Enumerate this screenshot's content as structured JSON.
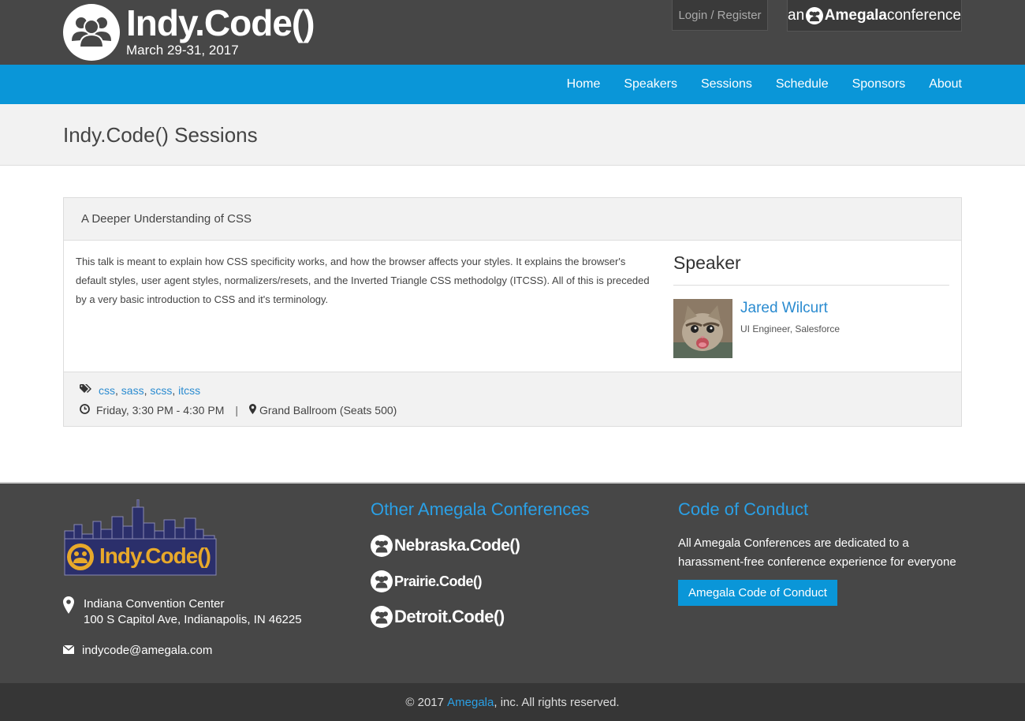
{
  "header": {
    "logo_title": "Indy.Code()",
    "logo_date": "March 29-31, 2017",
    "login_label": "Login / Register",
    "badge": {
      "prefix": "an",
      "brand": "Amegala",
      "suffix": "conference"
    }
  },
  "nav": {
    "items": [
      {
        "label": "Home"
      },
      {
        "label": "Speakers"
      },
      {
        "label": "Sessions"
      },
      {
        "label": "Schedule"
      },
      {
        "label": "Sponsors"
      },
      {
        "label": "About"
      }
    ]
  },
  "page": {
    "title": "Indy.Code() Sessions"
  },
  "session": {
    "title": "A Deeper Understanding of CSS",
    "description": "This talk is meant to explain how CSS specificity works, and how the browser affects your styles. It explains the browser's default styles, user agent styles, normalizers/resets, and the Inverted Triangle CSS methodolgy (ITCSS). All of this is preceded by a very basic introduction to CSS and it's terminology.",
    "speaker_heading": "Speaker",
    "speaker": {
      "name": "Jared Wilcurt",
      "title": "UI Engineer, Salesforce"
    },
    "tags": [
      "css",
      "sass",
      "scss",
      "itcss"
    ],
    "time": "Friday, 3:30 PM - 4:30 PM",
    "separator": "|",
    "room": "Grand Ballroom (Seats 500)"
  },
  "footer": {
    "logo_text": "Indy.Code()",
    "address_line1": "Indiana Convention Center",
    "address_line2": "100 S Capitol Ave, Indianapolis, IN 46225",
    "email": "indycode@amegala.com",
    "other_heading": "Other Amegala Conferences",
    "conferences": [
      {
        "label": "Nebraska.Code()"
      },
      {
        "label": "Prairie.Code()"
      },
      {
        "label": "Detroit.Code()"
      }
    ],
    "coc_heading": "Code of Conduct",
    "coc_text": "All Amegala Conferences are dedicated to a harassment-free conference experience for everyone",
    "coc_button": "Amegala Code of Conduct"
  },
  "copyright": {
    "prefix": "© 2017",
    "link": "Amegala",
    "suffix": ", inc. All rights reserved."
  },
  "colors": {
    "accent": "#0a96d8",
    "dark": "#474747",
    "link": "#2a8bd0"
  }
}
